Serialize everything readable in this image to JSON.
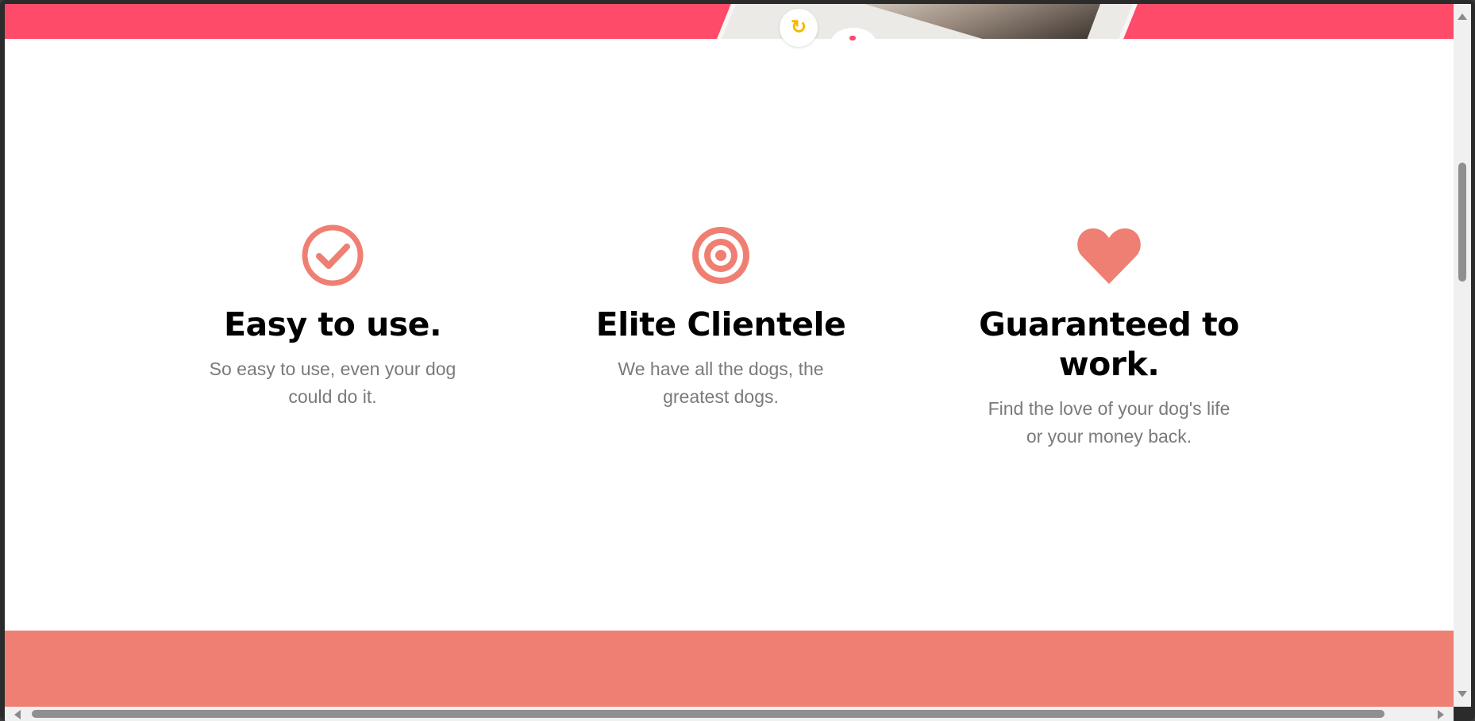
{
  "hero": {
    "undo_icon": "undo-icon",
    "like_icon": "heart-icon"
  },
  "colors": {
    "hero_accent": "#ff4b6a",
    "icon_accent": "#ef7f72",
    "cta_band": "#ef7f72",
    "heading": "#000000",
    "body_text": "#7a7a7a"
  },
  "features": [
    {
      "icon": "check-circle-icon",
      "title": "Easy to use.",
      "description": "So easy to use, even your dog could do it."
    },
    {
      "icon": "target-icon",
      "title": "Elite Clientele",
      "description": "We have all the dogs, the greatest dogs."
    },
    {
      "icon": "heart-icon",
      "title": "Guaranteed to work.",
      "description": "Find the love of your dog's life or your money back."
    }
  ]
}
